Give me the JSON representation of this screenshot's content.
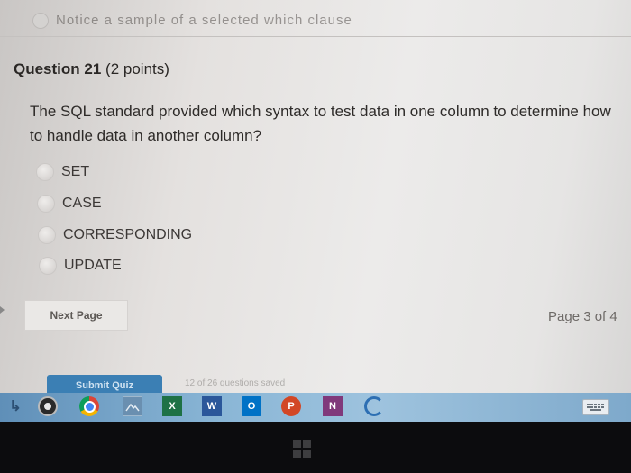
{
  "previous_question": {
    "fragment": "Notice a sample of a selected which clause"
  },
  "question": {
    "title": "Question 21",
    "points": "(2 points)",
    "text": "The SQL standard provided which syntax to test data in one column to determine how to handle data in another column?",
    "options": [
      {
        "label": "SET"
      },
      {
        "label": "CASE"
      },
      {
        "label": "CORRESPONDING"
      },
      {
        "label": "UPDATE"
      }
    ]
  },
  "navigation": {
    "next_label": "Next Page",
    "page_indicator": "Page 3 of 4"
  },
  "footer": {
    "submit_label": "Submit Quiz",
    "overlay_fragment": "12 of 26 questions saved"
  },
  "taskbar": {
    "icons": [
      {
        "name": "back-arrow-icon"
      },
      {
        "name": "media-player-icon"
      },
      {
        "name": "chrome-icon"
      },
      {
        "name": "photos-icon"
      },
      {
        "name": "excel-icon",
        "letter": "X"
      },
      {
        "name": "word-icon",
        "letter": "W"
      },
      {
        "name": "outlook-icon",
        "letter": "O"
      },
      {
        "name": "powerpoint-icon",
        "letter": "P"
      },
      {
        "name": "onenote-icon",
        "letter": "N"
      },
      {
        "name": "edge-icon"
      },
      {
        "name": "keyboard-icon"
      }
    ]
  },
  "colors": {
    "submit_button": "#3b7fb4",
    "taskbar": "#8ab6d6",
    "page_background": "#ecebea"
  }
}
